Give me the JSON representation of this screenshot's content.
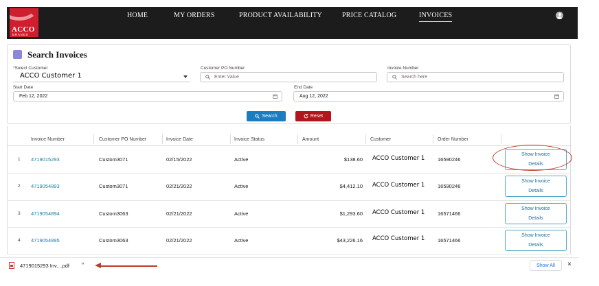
{
  "nav": {
    "logo_text": "ACCO",
    "logo_sub": "BRANDS",
    "items": [
      {
        "label": "HOME"
      },
      {
        "label": "MY ORDERS"
      },
      {
        "label": "PRODUCT AVAILABILITY"
      },
      {
        "label": "PRICE CATALOG"
      },
      {
        "label": "INVOICES",
        "active": true
      }
    ]
  },
  "search": {
    "title": "Search Invoices",
    "select_customer": {
      "label": "Select Customer",
      "required": "*",
      "value": "ACCO Customer 1"
    },
    "po_number": {
      "label": "Customer PO Number",
      "placeholder": "Enter Value"
    },
    "invoice_number": {
      "label": "Invoice Number",
      "placeholder": "Search here"
    },
    "start_date": {
      "label": "Start Date",
      "value": "Feb 12, 2022"
    },
    "end_date": {
      "label": "End Date",
      "value": "Aug 12, 2022"
    },
    "search_button": "Search",
    "reset_button": "Reset"
  },
  "table": {
    "columns": [
      "Invoice Number",
      "Customer PO Number",
      "Invoice Date",
      "Invoice Status",
      "Amount",
      "Customer",
      "Order Number"
    ],
    "detail_label_1": "Show Invoice",
    "detail_label_2": "Details",
    "rows": [
      {
        "n": "1",
        "invoice": "4719015293",
        "po": "Custom3071",
        "date": "02/15/2022",
        "status": "Active",
        "amount": "$138.60",
        "customer": "ACCO Customer 1",
        "order": "16590246"
      },
      {
        "n": "2",
        "invoice": "4719054893",
        "po": "Custom3071",
        "date": "02/21/2022",
        "status": "Active",
        "amount": "$4,412.10",
        "customer": "ACCO Customer 1",
        "order": "16590246"
      },
      {
        "n": "3",
        "invoice": "4719054894",
        "po": "Custom3063",
        "date": "02/21/2022",
        "status": "Active",
        "amount": "$1,293.60",
        "customer": "ACCO Customer 1",
        "order": "16571466"
      },
      {
        "n": "4",
        "invoice": "4719054895",
        "po": "Custom3063",
        "date": "02/21/2022",
        "status": "Active",
        "amount": "$43,226.16",
        "customer": "ACCO Customer 1",
        "order": "16571466"
      }
    ]
  },
  "downloads": {
    "file_name": "4719015293 Inv....pdf",
    "chevron": "^",
    "show_all": "Show All",
    "close": "×"
  },
  "colors": {
    "nav_bg": "#1c1c1c",
    "brand_red": "#cf1f2e",
    "search_button": "#1b7cc0",
    "reset_button": "#b0161b",
    "link": "#1b7ea0",
    "annotation_red": "#c0392b"
  }
}
